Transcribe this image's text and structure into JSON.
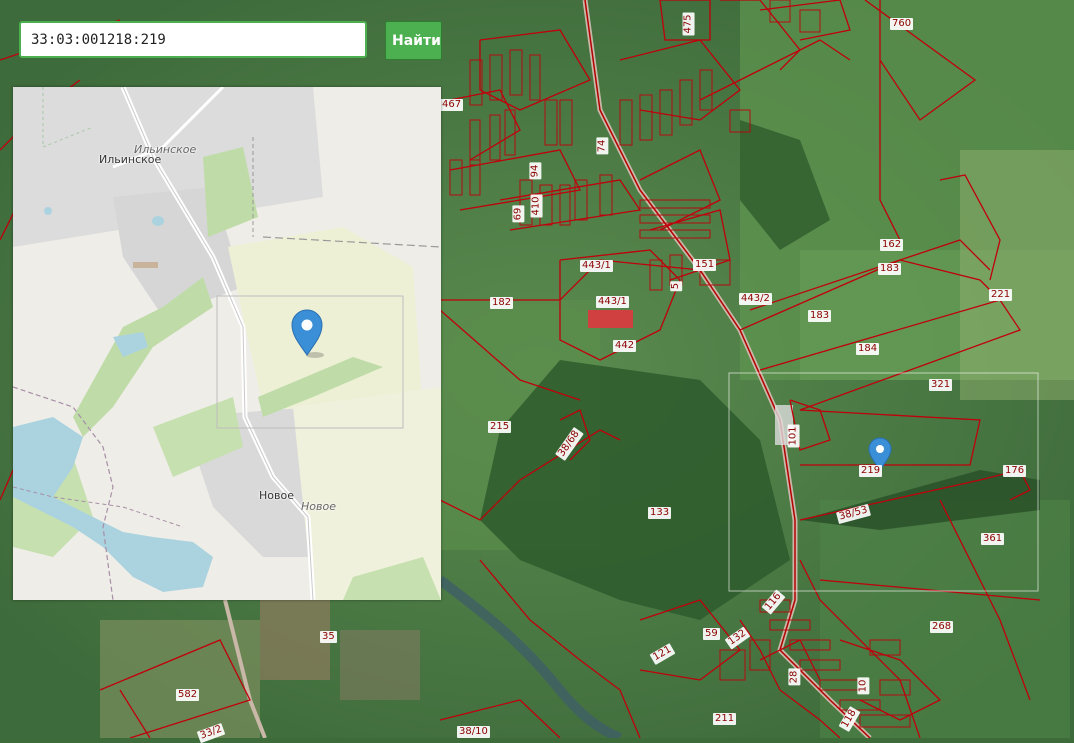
{
  "search": {
    "value": "33:03:001218:219",
    "button_label": "Найти"
  },
  "minimap": {
    "place_labels": [
      "Ильинское",
      "Ильинское",
      "Новое",
      "Новое"
    ]
  },
  "parcels": [
    "475",
    "760",
    "467",
    "74",
    "94",
    "410",
    "69",
    "443/1",
    "443/1",
    "5",
    "151",
    "443/2",
    "162",
    "183",
    "183",
    "221",
    "184",
    "182",
    "442",
    "215",
    "321",
    "38/68",
    "101",
    "219",
    "176",
    "38/53",
    "133",
    "361",
    "116",
    "59",
    "132",
    "121",
    "268",
    "35",
    "28",
    "10",
    "582",
    "118",
    "211",
    "38/10",
    "33/2"
  ],
  "marker": {
    "icon": "map-pin-icon",
    "color": "#3a8fd6"
  },
  "colors": {
    "parcel_border": "#c0000b",
    "button": "#4caf50"
  }
}
